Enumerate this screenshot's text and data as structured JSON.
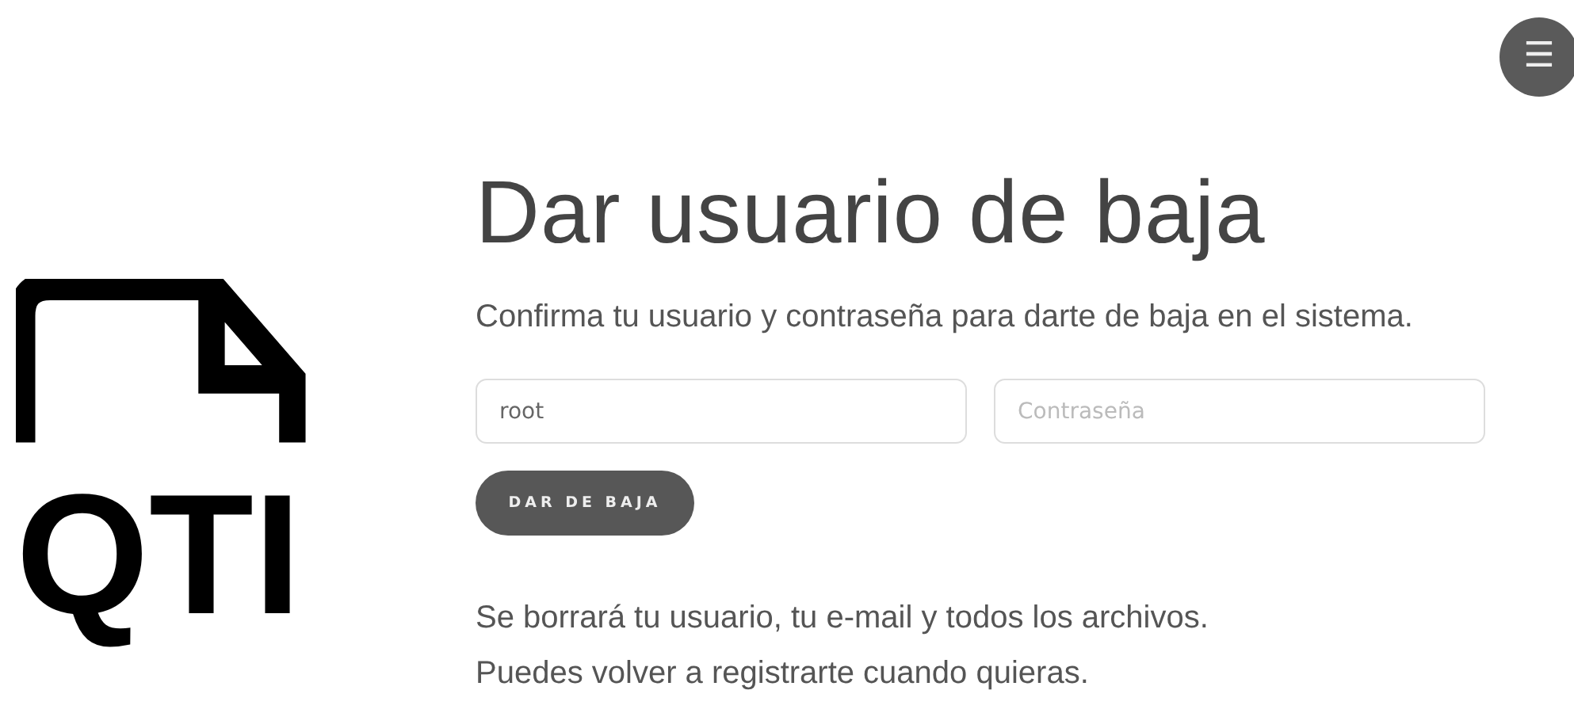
{
  "menu_button": {
    "label": "☰"
  },
  "logo": {
    "text": "QTI"
  },
  "title": "Dar usuario de baja",
  "subtitle": "Confirma tu usuario y contraseña para darte de baja en el sistema.",
  "form": {
    "username": {
      "value": "root"
    },
    "password": {
      "placeholder": "Contraseña"
    },
    "submit": "DAR DE BAJA"
  },
  "notes": [
    "Se borrará tu usuario, tu e-mail y todos los archivos.",
    "Puedes volver a registrarte cuando quieras."
  ]
}
